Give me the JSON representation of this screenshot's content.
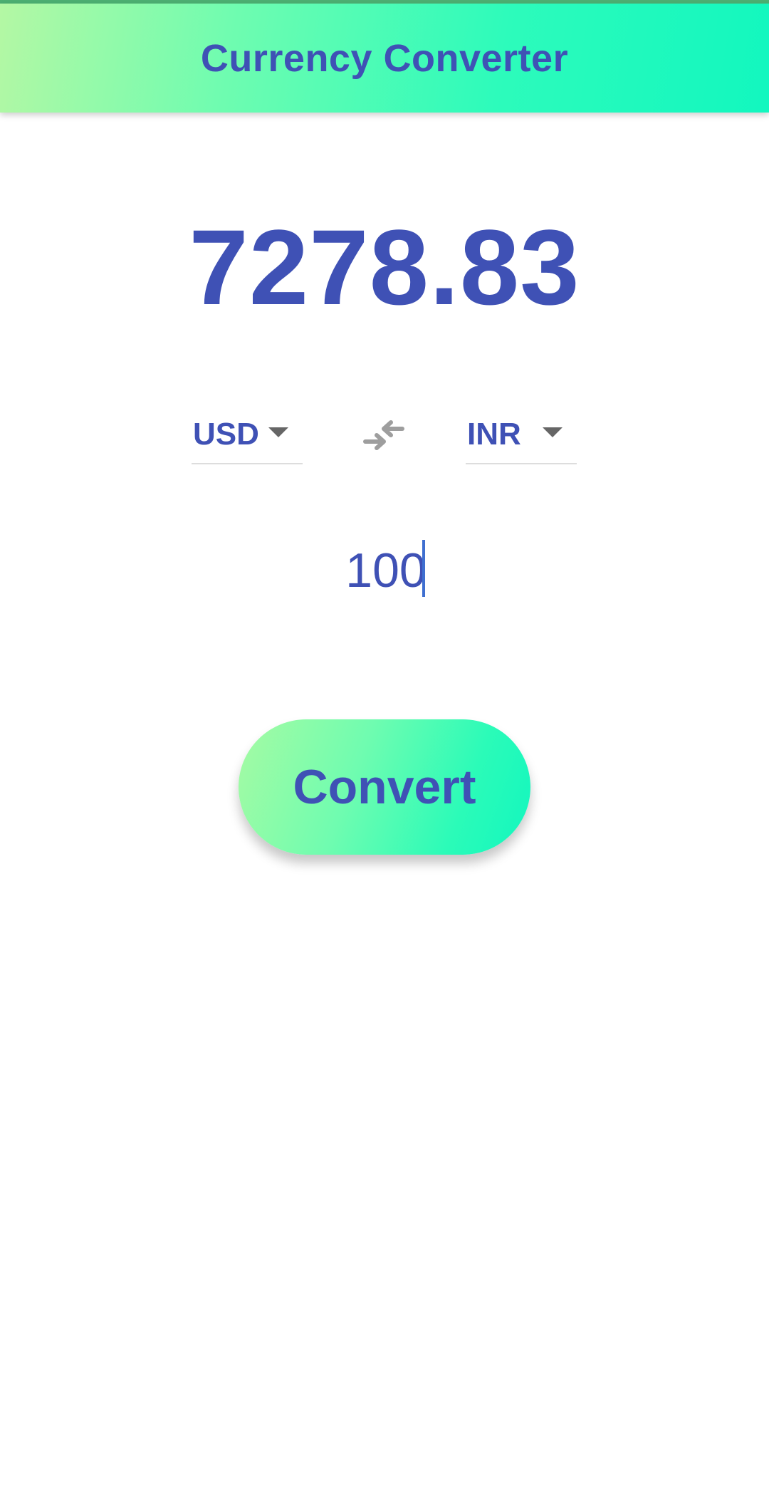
{
  "app_bar": {
    "title": "Currency Converter"
  },
  "result": {
    "value": "7278.83"
  },
  "from_currency": {
    "code": "USD"
  },
  "to_currency": {
    "code": "INR"
  },
  "swap": {
    "icon": "swap-arrows-icon"
  },
  "amount": {
    "value": "100"
  },
  "convert": {
    "label": "Convert"
  },
  "colors": {
    "primary_text": "#3f51b5",
    "gradient_start": "#b4f8a4",
    "gradient_end": "#12f7bf",
    "caret": "#666666"
  }
}
